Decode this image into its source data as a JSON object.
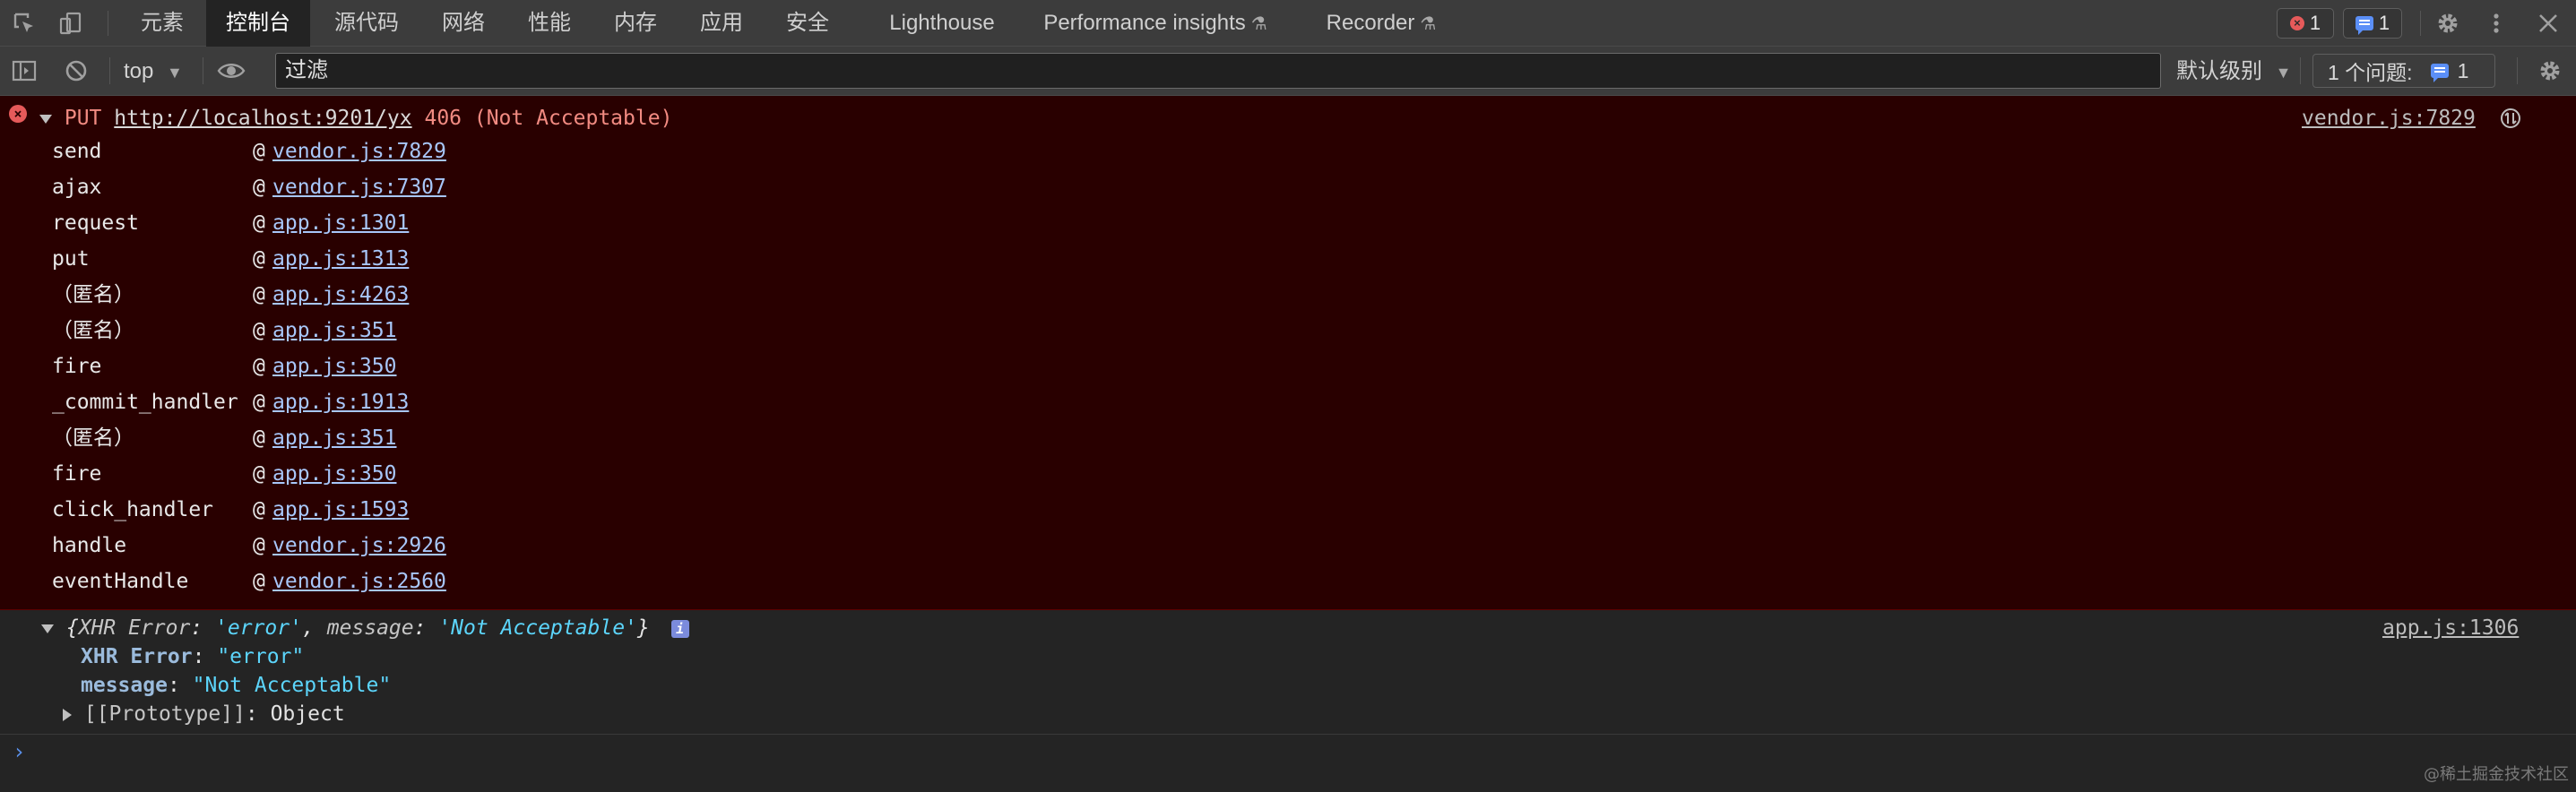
{
  "tabs": [
    {
      "label": "元素"
    },
    {
      "label": "控制台"
    },
    {
      "label": "源代码"
    },
    {
      "label": "网络"
    },
    {
      "label": "性能"
    },
    {
      "label": "内存"
    },
    {
      "label": "应用"
    },
    {
      "label": "安全"
    },
    {
      "label": "Lighthouse"
    },
    {
      "label": "Performance insights"
    },
    {
      "label": "Recorder"
    }
  ],
  "active_tab": "控制台",
  "badges": {
    "errors": "1",
    "messages": "1"
  },
  "toolbar": {
    "context": "top",
    "filter_placeholder": "过滤",
    "levels": "默认级别",
    "issues_label": "1 个问题:",
    "issues_count": "1"
  },
  "error": {
    "method": "PUT",
    "url": "http://localhost:9201/yx",
    "status": "406 (Not Acceptable)",
    "source": "vendor.js:7829",
    "stack": [
      {
        "fn": "send",
        "loc": "vendor.js:7829"
      },
      {
        "fn": "ajax",
        "loc": "vendor.js:7307"
      },
      {
        "fn": "request",
        "loc": "app.js:1301"
      },
      {
        "fn": "put",
        "loc": "app.js:1313"
      },
      {
        "fn": "（匿名）",
        "loc": "app.js:4263"
      },
      {
        "fn": "（匿名）",
        "loc": "app.js:351"
      },
      {
        "fn": "fire",
        "loc": "app.js:350"
      },
      {
        "fn": "_commit_handler",
        "loc": "app.js:1913"
      },
      {
        "fn": "（匿名）",
        "loc": "app.js:351"
      },
      {
        "fn": "fire",
        "loc": "app.js:350"
      },
      {
        "fn": "click_handler",
        "loc": "app.js:1593"
      },
      {
        "fn": "handle",
        "loc": "vendor.js:2926"
      },
      {
        "fn": "eventHandle",
        "loc": "vendor.js:2560"
      }
    ]
  },
  "object_log": {
    "preview_open": "{",
    "preview_key1": "XHR Error",
    "preview_colon1": ": ",
    "preview_val1": "'error'",
    "preview_sep": ", ",
    "preview_key2": "message",
    "preview_colon2": ": ",
    "preview_val2": "'Not Acceptable'",
    "preview_close": "}",
    "source": "app.js:1306",
    "props": [
      {
        "key": "XHR Error",
        "value": "\"error\""
      },
      {
        "key": "message",
        "value": "\"Not Acceptable\""
      }
    ],
    "proto_key": "[[Prototype]]",
    "proto_value": "Object"
  },
  "prompt_symbol": "›",
  "watermark": "@稀土掘金技术社区"
}
